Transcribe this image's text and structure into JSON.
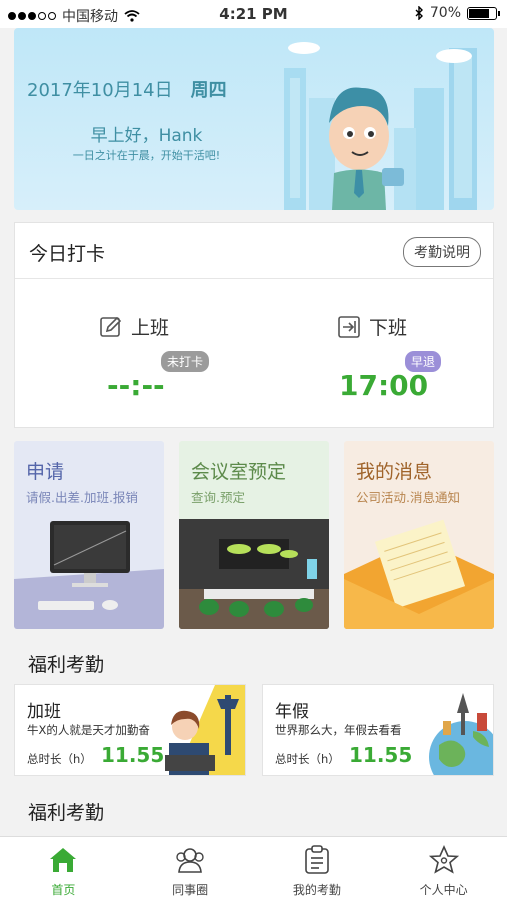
{
  "status_bar": {
    "carrier": "中国移动",
    "time": "4:21 PM",
    "battery": "70%",
    "battery_level": 0.7
  },
  "banner": {
    "date": "2017年10月14日",
    "weekday": "周四",
    "greeting": "早上好，Hank",
    "subtitle": "一日之计在于晨，开始干活吧!"
  },
  "punch": {
    "title": "今日打卡",
    "explain_button": "考勤说明",
    "on_duty": {
      "label": "上班",
      "badge": "未打卡",
      "time": "--:--"
    },
    "off_duty": {
      "label": "下班",
      "badge": "早退",
      "time": "17:00"
    }
  },
  "tiles": [
    {
      "title": "申请",
      "subtitle": "请假.出差.加班.报销"
    },
    {
      "title": "会议室预定",
      "subtitle": "查询.预定"
    },
    {
      "title": "我的消息",
      "subtitle": "公司活动.消息通知"
    }
  ],
  "welfare_section_1": "福利考勤",
  "welfare_cards": [
    {
      "title": "加班",
      "desc": "牛X的人就是天才加勤奋",
      "hours_label": "总时长（h）",
      "hours": "11.55"
    },
    {
      "title": "年假",
      "desc": "世界那么大，年假去看看",
      "hours_label": "总时长（h）",
      "hours": "11.55"
    }
  ],
  "welfare_section_2": "福利考勤",
  "tabbar": [
    {
      "label": "首页",
      "icon": "home-icon",
      "active": true
    },
    {
      "label": "同事圈",
      "icon": "colleagues-icon",
      "active": false
    },
    {
      "label": "我的考勤",
      "icon": "attendance-icon",
      "active": false
    },
    {
      "label": "个人中心",
      "icon": "star-icon",
      "active": false
    }
  ],
  "colors": {
    "accent_green": "#3aaa35",
    "banner_text": "#3f8fa3",
    "badge_gray": "#9b9b9b",
    "badge_purple": "#9b8fd8"
  }
}
